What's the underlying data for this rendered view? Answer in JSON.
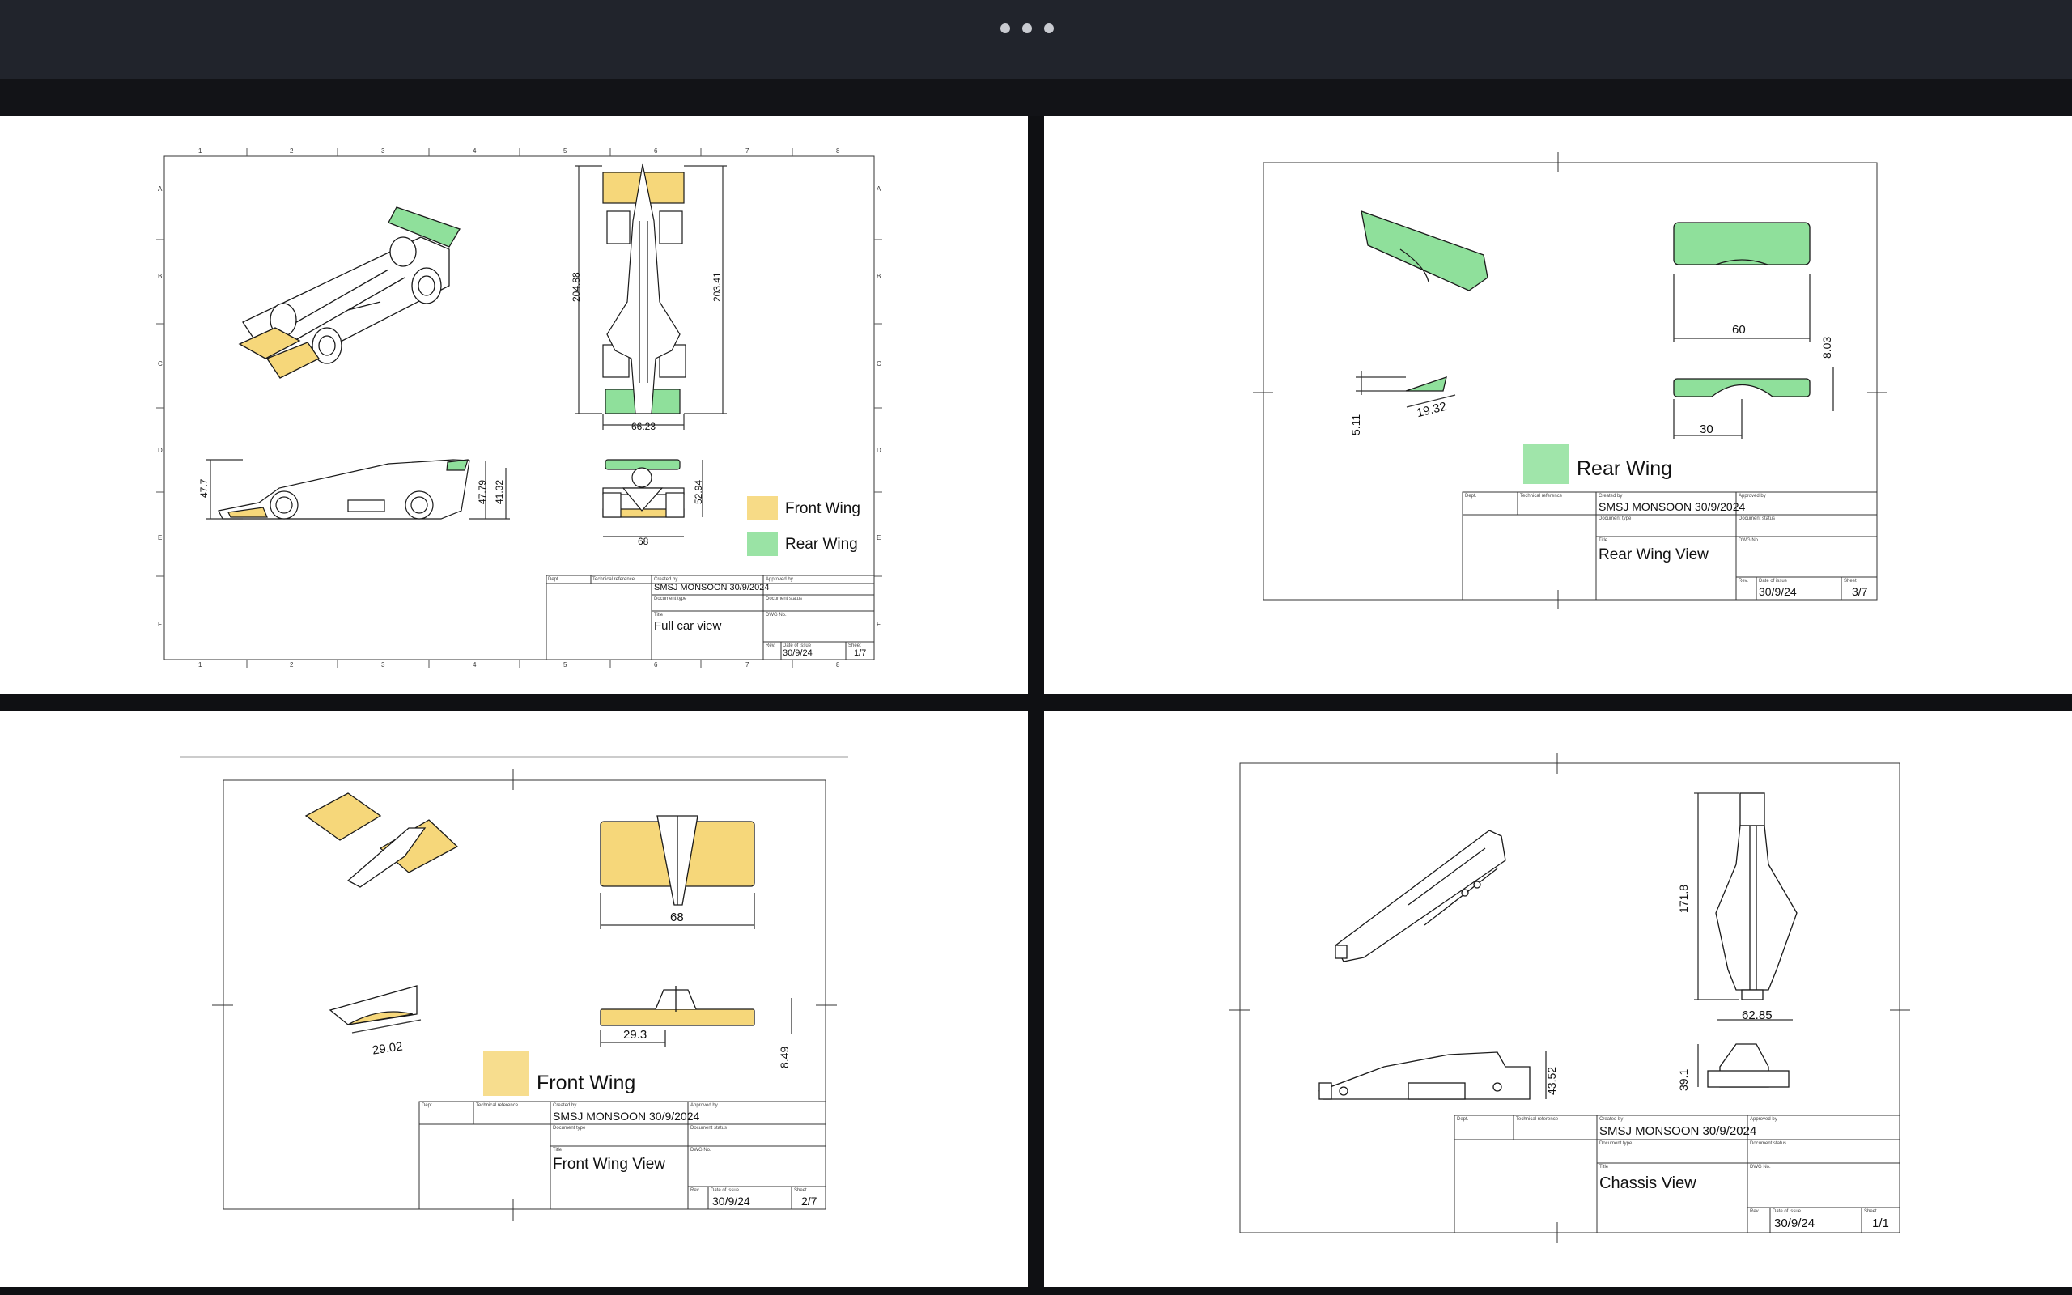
{
  "window": {
    "menu_icon": "more-horizontal-dots",
    "background": "#0f1013",
    "topbar_color": "#21242c"
  },
  "colors": {
    "front_wing_yellow": "#f6d77a",
    "rear_wing_green": "#8fe09b",
    "line": "#1a1a1a"
  },
  "sheet1": {
    "col_labels": [
      "1",
      "2",
      "3",
      "4",
      "5",
      "6",
      "7",
      "8"
    ],
    "row_labels": [
      "A",
      "B",
      "C",
      "D",
      "E",
      "F"
    ],
    "dims": {
      "length_top": "204.88",
      "length_top2": "203.41",
      "width_top": "66.23",
      "side_height": "47.7",
      "side_h1": "47.79",
      "side_h2": "41.32",
      "front_height": "52.94",
      "front_width": "68"
    },
    "legend": {
      "front": "Front Wing",
      "rear": "Rear Wing"
    },
    "title_block": {
      "dept": "Dept.",
      "tech_ref": "Technical reference",
      "created_by_lbl": "Created by",
      "created_by": "SMSJ MONSOON 30/9/2024",
      "approved_by_lbl": "Approved by",
      "doc_type_lbl": "Document type",
      "doc_status_lbl": "Document status",
      "title_lbl": "Title",
      "title": "Full car view",
      "dwg_lbl": "DWG No.",
      "rev_lbl": "Rev.",
      "date_lbl": "Date of issue",
      "date": "30/9/24",
      "sheet_lbl": "Sheet",
      "sheet": "1/7"
    }
  },
  "sheet2": {
    "dims": {
      "width": "60",
      "height": "8.03",
      "cut": "30",
      "side_h": "5.11",
      "side_w": "19.32"
    },
    "legend": "Rear Wing",
    "title_block": {
      "dept": "Dept.",
      "tech_ref": "Technical reference",
      "created_by_lbl": "Created by",
      "created_by": "SMSJ MONSOON 30/9/2024",
      "approved_by_lbl": "Approved by",
      "doc_type_lbl": "Document type",
      "doc_status_lbl": "Document status",
      "title_lbl": "Title",
      "title": "Rear Wing View",
      "dwg_lbl": "DWG No.",
      "rev_lbl": "Rev.",
      "date_lbl": "Date of issue",
      "date": "30/9/24",
      "sheet_lbl": "Sheet",
      "sheet": "3/7"
    }
  },
  "sheet3": {
    "dims": {
      "width": "68",
      "side_w": "29.02",
      "front_w": "29.3",
      "front_h": "8.49"
    },
    "legend": "Front Wing",
    "title_block": {
      "dept": "Dept.",
      "tech_ref": "Technical reference",
      "created_by_lbl": "Created by",
      "created_by": "SMSJ MONSOON 30/9/2024",
      "approved_by_lbl": "Approved by",
      "doc_type_lbl": "Document type",
      "doc_status_lbl": "Document status",
      "title_lbl": "Title",
      "title": "Front Wing View",
      "dwg_lbl": "DWG No.",
      "rev_lbl": "Rev.",
      "date_lbl": "Date of issue",
      "date": "30/9/24",
      "sheet_lbl": "Sheet",
      "sheet": "2/7"
    }
  },
  "sheet4": {
    "dims": {
      "length": "171.8",
      "width": "62.85",
      "front_h": "39.1",
      "side_h": "43.52"
    },
    "title_block": {
      "dept": "Dept.",
      "tech_ref": "Technical reference",
      "created_by_lbl": "Created by",
      "created_by": "SMSJ MONSOON 30/9/2024",
      "approved_by_lbl": "Approved by",
      "doc_type_lbl": "Document type",
      "doc_status_lbl": "Document status",
      "title_lbl": "Title",
      "title": "Chassis View",
      "dwg_lbl": "DWG No.",
      "rev_lbl": "Rev.",
      "date_lbl": "Date of issue",
      "date": "30/9/24",
      "sheet_lbl": "Sheet",
      "sheet": "1/1"
    }
  }
}
